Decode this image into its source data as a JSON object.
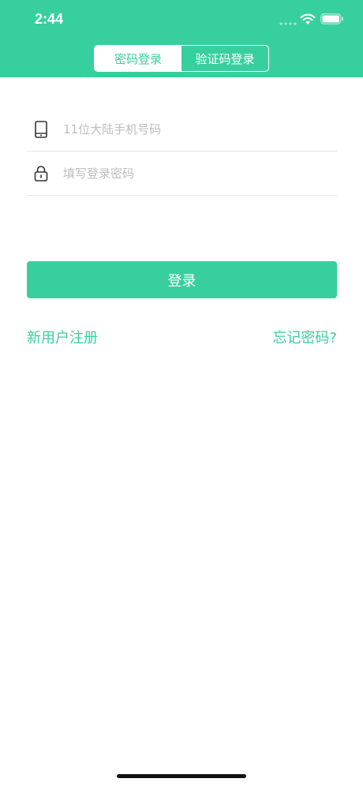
{
  "status_bar": {
    "time": "2:44"
  },
  "tabs": [
    {
      "label": "密码登录",
      "active": true
    },
    {
      "label": "验证码登录",
      "active": false
    }
  ],
  "form": {
    "phone_placeholder": "11位大陆手机号码",
    "phone_value": "",
    "password_placeholder": "填写登录密码",
    "password_value": "",
    "phone_icon": "phone-icon",
    "password_icon": "lock-icon"
  },
  "actions": {
    "login_label": "登录",
    "register_label": "新用户注册",
    "forgot_label": "忘记密码?"
  },
  "colors": {
    "accent": "#38cf9f",
    "divider": "#e6e6e6",
    "placeholder": "#bdbdbd"
  }
}
